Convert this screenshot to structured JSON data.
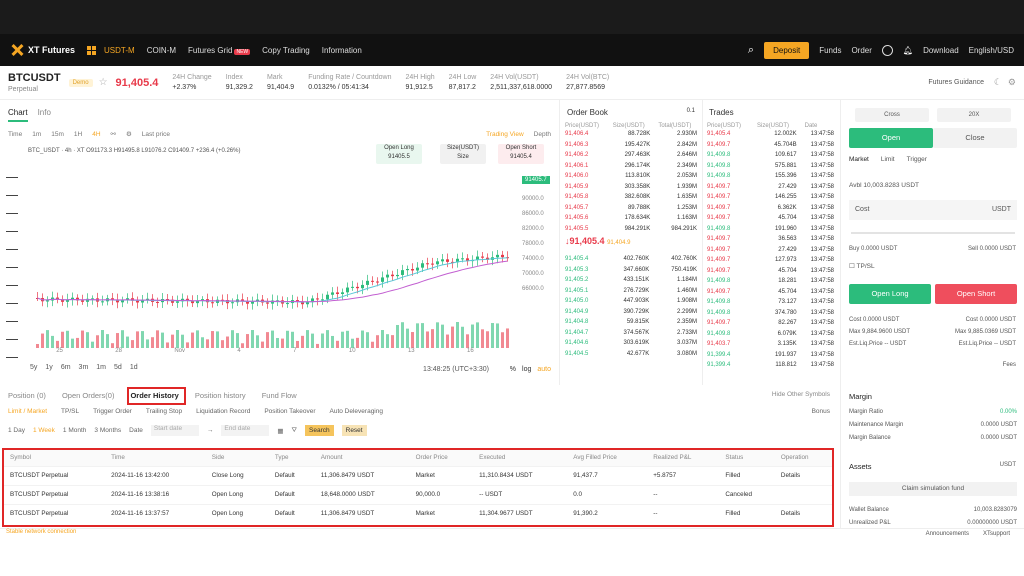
{
  "nav": {
    "logo": "XT Futures",
    "items": [
      "USDT-M",
      "COIN-M",
      "Futures Grid",
      "Copy Trading",
      "Information"
    ],
    "new_badge": "NEW",
    "deposit": "Deposit",
    "funds": "Funds",
    "order": "Order",
    "download": "Download",
    "lang": "English/USD"
  },
  "ticker": {
    "symbol": "BTCUSDT",
    "sub": "Perpetual",
    "demo": "Demo",
    "price": "91,405.4",
    "stats": [
      {
        "label": "24H Change",
        "value": "+2.37%"
      },
      {
        "label": "Index",
        "value": "91,329.2"
      },
      {
        "label": "Mark",
        "value": "91,404.9"
      },
      {
        "label": "Funding Rate / Countdown",
        "value": "0.0132% / 05:41:34"
      },
      {
        "label": "24H High",
        "value": "91,912.5"
      },
      {
        "label": "24H Low",
        "value": "87,817.2"
      },
      {
        "label": "24H Vol(USDT)",
        "value": "2,511,337,618.0000"
      },
      {
        "label": "24H Vol(BTC)",
        "value": "27,877.8569"
      }
    ],
    "guide": "Futures Guidance"
  },
  "chart": {
    "tabs": [
      "Chart",
      "Info"
    ],
    "timeframes": [
      "Time",
      "1m",
      "15m",
      "1H",
      "4H",
      "Last price"
    ],
    "trading_view": "Trading View",
    "depth": "Depth",
    "indicator": "BTC_USDT · 4h · XT   O91173.3  H91495.8  L91076.2  C91409.7  +236.4 (+0.26%)",
    "open_long": "Open Long",
    "open_long_price": "91405.5",
    "size_label": "Size(USDT)",
    "size": "Size",
    "open_short": "Open Short",
    "open_short_price": "91405.4",
    "price_tag": "91405.7",
    "y_ticks": [
      "90000.0",
      "88000.0",
      "86000.0",
      "84000.0",
      "82000.0",
      "80000.0",
      "78000.0",
      "76000.0",
      "74000.0",
      "72000.0",
      "70000.0",
      "68000.0",
      "66000.0"
    ],
    "x_ticks": [
      "25",
      "28",
      "Nov",
      "4",
      "7",
      "10",
      "13",
      "16"
    ],
    "periods": [
      "5y",
      "1y",
      "6m",
      "3m",
      "1m",
      "5d",
      "1d"
    ],
    "time_display": "13:48:25 (UTC+3:30)",
    "pct": "%",
    "log": "log",
    "auto": "auto"
  },
  "order_book": {
    "title": "Order Book",
    "step": "0.1",
    "headers": [
      "Price(USDT)",
      "Size(USDT)",
      "Total(USDT)"
    ],
    "asks": [
      [
        "91,406.4",
        "88.728K",
        "2.930M"
      ],
      [
        "91,406.3",
        "195.427K",
        "2.842M"
      ],
      [
        "91,406.2",
        "297.463K",
        "2.646M"
      ],
      [
        "91,406.1",
        "296.174K",
        "2.349M"
      ],
      [
        "91,406.0",
        "113.810K",
        "2.053M"
      ],
      [
        "91,405.9",
        "303.358K",
        "1.939M"
      ],
      [
        "91,405.8",
        "382.608K",
        "1.635M"
      ],
      [
        "91,405.7",
        "89.788K",
        "1.253M"
      ],
      [
        "91,405.6",
        "178.634K",
        "1.163M"
      ],
      [
        "91,405.5",
        "984.291K",
        "984.291K"
      ]
    ],
    "mid": "↓91,405.4",
    "mid_mark": "91,404.9",
    "bids": [
      [
        "91,405.4",
        "402.760K",
        "402.760K"
      ],
      [
        "91,405.3",
        "347.660K",
        "750.419K"
      ],
      [
        "91,405.2",
        "433.151K",
        "1.184M"
      ],
      [
        "91,405.1",
        "276.729K",
        "1.460M"
      ],
      [
        "91,405.0",
        "447.903K",
        "1.908M"
      ],
      [
        "91,404.9",
        "390.729K",
        "2.299M"
      ],
      [
        "91,404.8",
        "59.815K",
        "2.359M"
      ],
      [
        "91,404.7",
        "374.567K",
        "2.733M"
      ],
      [
        "91,404.6",
        "303.619K",
        "3.037M"
      ],
      [
        "91,404.5",
        "42.677K",
        "3.080M"
      ]
    ]
  },
  "trades": {
    "title": "Trades",
    "headers": [
      "Price(USDT)",
      "Size(USDT)",
      "Date"
    ],
    "rows": [
      [
        "91,405.4",
        "12.002K",
        "13:47:58",
        "r"
      ],
      [
        "91,409.7",
        "45.704B",
        "13:47:58",
        "r"
      ],
      [
        "91,409.8",
        "109.617",
        "13:47:58",
        "g"
      ],
      [
        "91,409.8",
        "575.881",
        "13:47:58",
        "g"
      ],
      [
        "91,409.8",
        "155.396",
        "13:47:58",
        "g"
      ],
      [
        "91,409.7",
        "27.429",
        "13:47:58",
        "r"
      ],
      [
        "91,409.7",
        "146.255",
        "13:47:58",
        "r"
      ],
      [
        "91,409.7",
        "6.362K",
        "13:47:58",
        "r"
      ],
      [
        "91,409.7",
        "45.704",
        "13:47:58",
        "r"
      ],
      [
        "91,409.8",
        "191.960",
        "13:47:58",
        "g"
      ],
      [
        "91,409.7",
        "36.563",
        "13:47:58",
        "r"
      ],
      [
        "91,409.7",
        "27.429",
        "13:47:58",
        "r"
      ],
      [
        "91,409.7",
        "127.973",
        "13:47:58",
        "r"
      ],
      [
        "91,409.7",
        "45.704",
        "13:47:58",
        "r"
      ],
      [
        "91,409.8",
        "18.281",
        "13:47:58",
        "g"
      ],
      [
        "91,409.7",
        "45.704",
        "13:47:58",
        "r"
      ],
      [
        "91,409.8",
        "73.127",
        "13:47:58",
        "g"
      ],
      [
        "91,409.8",
        "374.780",
        "13:47:58",
        "g"
      ],
      [
        "91,409.7",
        "82.267",
        "13:47:58",
        "r"
      ],
      [
        "91,409.8",
        "6.079K",
        "13:47:58",
        "g"
      ],
      [
        "91,403.7",
        "3.135K",
        "13:47:58",
        "r"
      ],
      [
        "91,399.4",
        "191.937",
        "13:47:58",
        "g"
      ],
      [
        "91,399.4",
        "118.812",
        "13:47:58",
        "g"
      ]
    ]
  },
  "trade_panel": {
    "margin_mode": "Cross",
    "leverage": "20X",
    "open": "Open",
    "close": "Close",
    "types": [
      "Market",
      "Limit",
      "Trigger"
    ],
    "avbl": "Avbl 10,003.8283 USDT",
    "cost": "Cost",
    "cost_unit": "USDT",
    "buy": "Buy 0.0000 USDT",
    "sell": "Sell 0.0000 USDT",
    "tpsl": "TP/SL",
    "open_long": "Open Long",
    "open_short": "Open Short",
    "left_info": [
      "Cost 0.0000 USDT",
      "Max 9,884.9600 USDT",
      "Est.Liq.Price -- USDT"
    ],
    "right_info": [
      "Cost 0.0000 USDT",
      "Max 9,885.0369 USDT",
      "Est.Liq.Price -- USDT"
    ],
    "fees": "Fees",
    "margin_title": "Margin",
    "margin_rows": [
      [
        "Margin Ratio",
        "0.00%"
      ],
      [
        "Maintenance Margin",
        "0.0000 USDT"
      ],
      [
        "Margin Balance",
        "0.0000 USDT"
      ]
    ],
    "assets_title": "Assets",
    "assets_unit": "USDT",
    "claim": "Claim simulation fund",
    "wallet": [
      "Wallet Balance",
      "10,003.8283079"
    ],
    "unrealized": [
      "Unrealized P&L",
      "0.00000000 USDT"
    ]
  },
  "bottom": {
    "tabs": [
      "Position (0)",
      "Open Orders(0)",
      "Order History",
      "Position history",
      "Fund Flow"
    ],
    "hide_other": "Hide Other Symbols",
    "subtabs": [
      "Limit / Market",
      "TP/SL",
      "Trigger Order",
      "Trailing Stop",
      "Liquidation Record",
      "Position Takeover",
      "Auto Deleveraging"
    ],
    "bonus": "Bonus",
    "filters": [
      "1 Day",
      "1 Week",
      "1 Month",
      "3 Months",
      "Date"
    ],
    "start_date": "Start date",
    "end_date": "End date",
    "search": "Search",
    "reset": "Reset",
    "headers": [
      "Symbol",
      "Time",
      "Side",
      "Type",
      "Amount",
      "Order Price",
      "Executed",
      "Avg Filled Price",
      "Realized P&L",
      "Status",
      "Operation"
    ],
    "rows": [
      [
        "BTCUSDT Perpetual",
        "2024-11-16 13:42:00",
        "Close Long",
        "Default",
        "11,306.8479 USDT",
        "Market",
        "11,310.8434 USDT",
        "91,437.7",
        "+5.8757",
        "Filled",
        "Details"
      ],
      [
        "BTCUSDT Perpetual",
        "2024-11-16 13:38:16",
        "Open Long",
        "Default",
        "18,648.0000 USDT",
        "90,000.0",
        "-- USDT",
        "0.0",
        "--",
        "Canceled",
        ""
      ],
      [
        "BTCUSDT Perpetual",
        "2024-11-16 13:37:57",
        "Open Long",
        "Default",
        "11,306.8479 USDT",
        "Market",
        "11,304.9677 USDT",
        "91,390.2",
        "--",
        "Filled",
        "Details"
      ]
    ]
  },
  "footer": {
    "status": "Stable network connection",
    "announcements": "Announcements",
    "support": "XTsupport"
  }
}
